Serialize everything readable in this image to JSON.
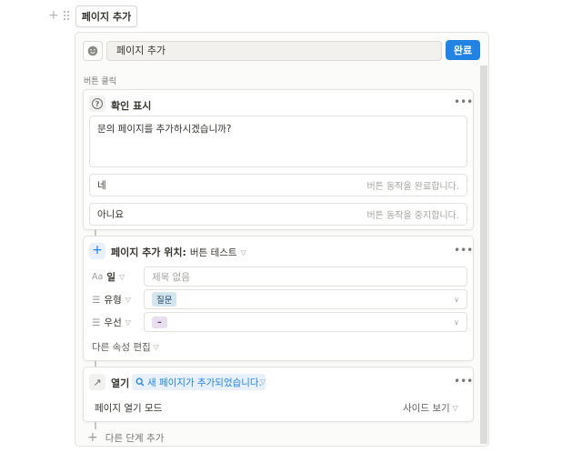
{
  "top_button": {
    "label": "페이지 추가"
  },
  "editor": {
    "title_value": "페이지 추가",
    "done_label": "완료",
    "section_label": "버튼 클릭"
  },
  "confirm_step": {
    "title": "확인 표시",
    "message": "문의 페이지를 추가하시겠습니까?",
    "options": [
      {
        "label": "네",
        "hint": "버튼 동작을 완료합니다."
      },
      {
        "label": "아니요",
        "hint": "버튼 동작을 중지합니다."
      }
    ]
  },
  "add_page_step": {
    "title": "페이지 추가 위치:",
    "target": "버튼 테스트",
    "properties": [
      {
        "type_icon": "Aa",
        "name": "일",
        "placeholder": "제목 없음"
      },
      {
        "type_icon": "☰",
        "name": "유형",
        "value": "질문",
        "value_color": "#d3e5ef"
      },
      {
        "type_icon": "☰",
        "name": "우선",
        "value": "–",
        "value_color": "#e8deee"
      }
    ],
    "edit_more_label": "다른 속성 편집"
  },
  "open_step": {
    "title": "열기",
    "chip_text": "새 페이지가 추가되었습니다.",
    "mode_label": "페이지 열기 모드",
    "mode_value": "사이드 보기"
  },
  "add_step_label": "다른 단계 추가",
  "colors": {
    "accent": "#2383e2",
    "border": "#e3e2df",
    "panel_bg": "#fbfbfa"
  }
}
